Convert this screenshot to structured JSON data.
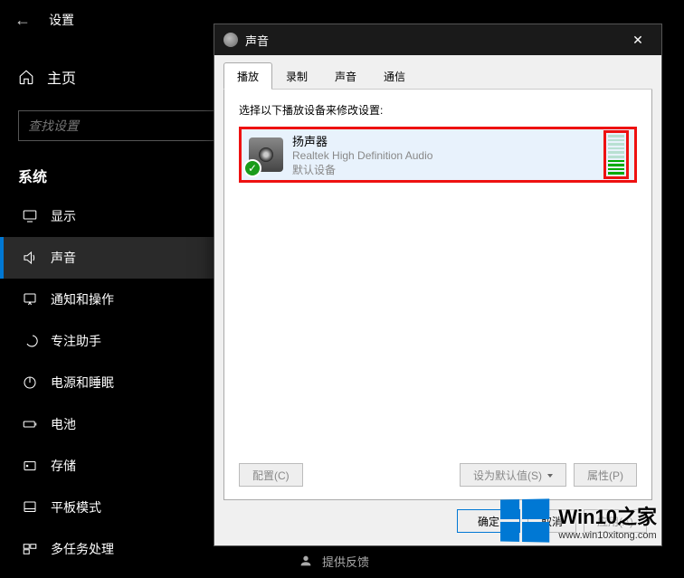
{
  "settings": {
    "title": "设置",
    "home": "主页",
    "search_placeholder": "查找设置",
    "section": "系统",
    "items": [
      {
        "label": "显示",
        "icon": "display"
      },
      {
        "label": "声音",
        "icon": "sound"
      },
      {
        "label": "通知和操作",
        "icon": "notify"
      },
      {
        "label": "专注助手",
        "icon": "focus"
      },
      {
        "label": "电源和睡眠",
        "icon": "power"
      },
      {
        "label": "电池",
        "icon": "battery"
      },
      {
        "label": "存储",
        "icon": "storage"
      },
      {
        "label": "平板模式",
        "icon": "tablet"
      },
      {
        "label": "多任务处理",
        "icon": "multitask"
      }
    ],
    "active_index": 1
  },
  "dialog": {
    "title": "声音",
    "tabs": [
      "播放",
      "录制",
      "声音",
      "通信"
    ],
    "active_tab": 0,
    "instruction": "选择以下播放设备来修改设置:",
    "device": {
      "name": "扬声器",
      "description": "Realtek High Definition Audio",
      "status": "默认设备",
      "vu_total": 10,
      "vu_lit": 4
    },
    "buttons": {
      "configure": "配置(C)",
      "set_default": "设为默认值(S)",
      "properties": "属性(P)",
      "ok": "确定",
      "cancel": "取消",
      "apply": "应用(A)"
    }
  },
  "feedback": "提供反馈",
  "watermark": {
    "brand": "Win10之家",
    "url": "www.win10xitong.com"
  }
}
